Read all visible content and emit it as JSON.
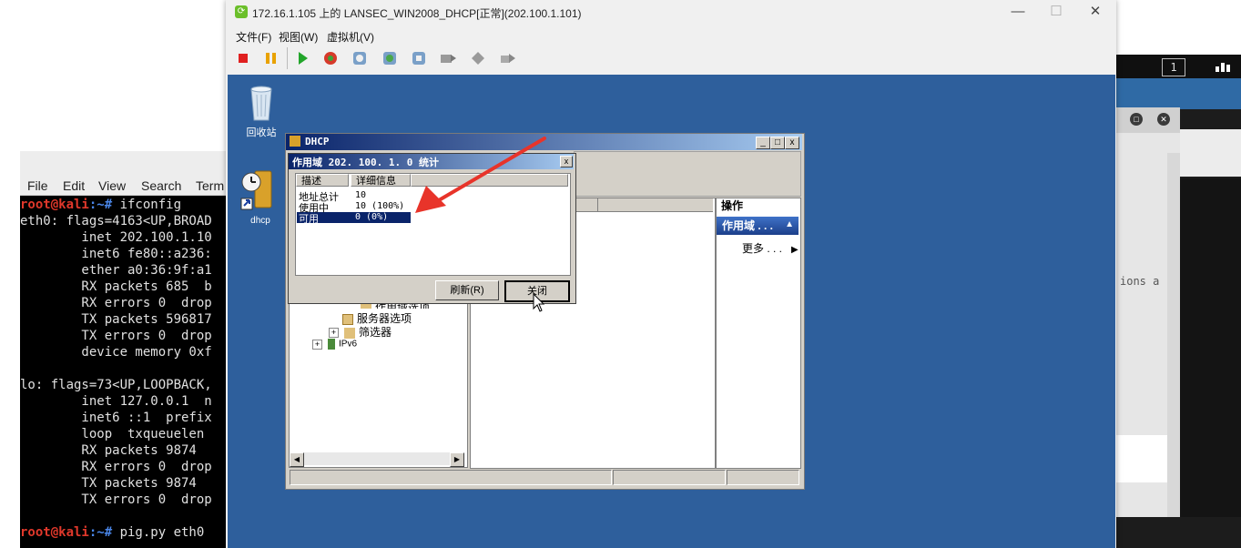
{
  "vm_window": {
    "title": "172.16.1.105 上的 LANSEC_WIN2008_DHCP[正常](202.100.1.101)",
    "menu": [
      "文件(F)",
      "视图(W)",
      "虚拟机(V)"
    ],
    "controls": {
      "minimize": "—",
      "maximize": "☐",
      "close": "✕"
    },
    "toolbar_icons": [
      "stop-icon",
      "pause-icon",
      "play-icon",
      "reset-icon",
      "snapshot-icon",
      "snapshot-revert-icon",
      "snapshot-manage-icon",
      "send-keys-icon",
      "tools-icon",
      "share-icon"
    ]
  },
  "desktop": {
    "recycle_bin_label": "回收站",
    "dhcp_label": "dhcp"
  },
  "mmc": {
    "title": "DHCP",
    "controls": {
      "minimize": "_",
      "maximize": "□",
      "close": "x"
    },
    "tree": {
      "partial_item": "作用域选项",
      "server_options": "服务器选项",
      "filters": "筛选器",
      "ipv6": "IPv6"
    },
    "actions": {
      "header": "操作",
      "scope": "作用域 . . .",
      "more": "更多 . . ."
    }
  },
  "stats_dialog": {
    "title": "作用域 202. 100. 1. 0 统计",
    "close": "x",
    "columns": [
      "描述",
      "详细信息"
    ],
    "rows": [
      {
        "label": "地址总计",
        "value": "10"
      },
      {
        "label": "使用中",
        "value": "10 (100%)"
      },
      {
        "label": "可用",
        "value": "0 (0%)"
      }
    ],
    "refresh_button": "刷新(R)",
    "close_button": "关闭"
  },
  "terminal": {
    "menu": [
      "File",
      "Edit",
      "View",
      "Search",
      "Term"
    ],
    "lines": [
      {
        "prompt_user": "root@kali",
        "prompt_path": ":~# ",
        "cmd": "ifconfig"
      },
      {
        "text": "eth0: flags=4163<UP,BROAD"
      },
      {
        "text": "        inet 202.100.1.10"
      },
      {
        "text": "        inet6 fe80::a236:"
      },
      {
        "text": "        ether a0:36:9f:a1"
      },
      {
        "text": "        RX packets 685  b"
      },
      {
        "text": "        RX errors 0  drop"
      },
      {
        "text": "        TX packets 596817"
      },
      {
        "text": "        TX errors 0  drop"
      },
      {
        "text": "        device memory 0xf"
      },
      {
        "text": ""
      },
      {
        "text": "lo: flags=73<UP,LOOPBACK,"
      },
      {
        "text": "        inet 127.0.0.1  n"
      },
      {
        "text": "        inet6 ::1  prefix"
      },
      {
        "text": "        loop  txqueuelen"
      },
      {
        "text": "        RX packets 9874"
      },
      {
        "text": "        RX errors 0  drop"
      },
      {
        "text": "        TX packets 9874"
      },
      {
        "text": "        TX errors 0  drop"
      },
      {
        "text": ""
      },
      {
        "prompt_user": "root@kali",
        "prompt_path": ":~# ",
        "cmd": "pig.py eth0"
      }
    ]
  },
  "background": {
    "workspace_number": "1",
    "ghost_text": "ions a"
  },
  "colors": {
    "vm_desktop": "#2e5f9c",
    "annotation_arrow": "#e8342a",
    "title_gradient_start": "#0a246a",
    "selection": "#0a246a"
  }
}
